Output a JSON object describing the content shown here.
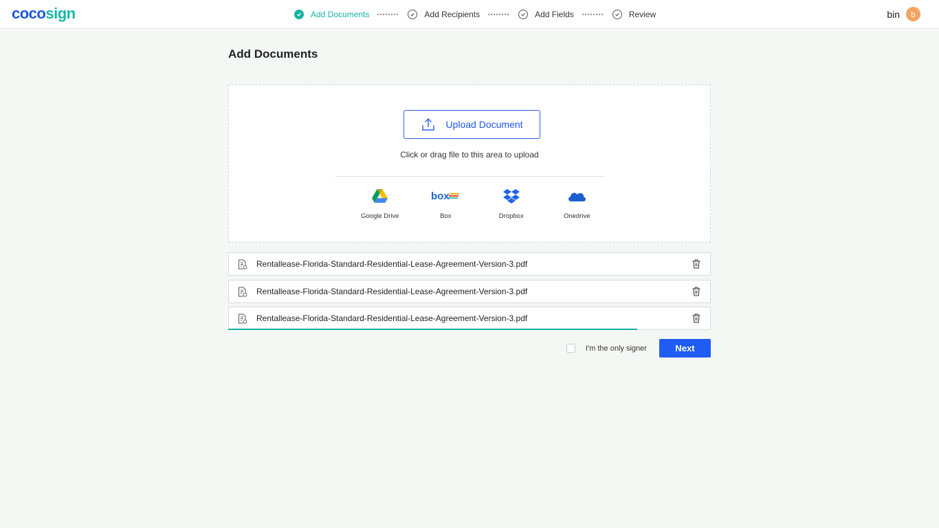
{
  "app": {
    "logo_part1": "coco",
    "logo_part2": "sign"
  },
  "steps": [
    {
      "label": "Add Documents",
      "active": true
    },
    {
      "label": "Add Recipients",
      "active": false
    },
    {
      "label": "Add Fields",
      "active": false
    },
    {
      "label": "Review",
      "active": false
    }
  ],
  "user": {
    "name": "bin",
    "initial": "b",
    "avatar_color": "#f4a261"
  },
  "page": {
    "title": "Add Documents"
  },
  "upload": {
    "button_label": "Upload Document",
    "hint": "Click or drag file to this area to upload",
    "providers": [
      {
        "label": "Google Drive",
        "icon": "google-drive-icon"
      },
      {
        "label": "Box",
        "icon": "box-icon"
      },
      {
        "label": "Dropbox",
        "icon": "dropbox-icon"
      },
      {
        "label": "Onedrive",
        "icon": "onedrive-icon"
      }
    ]
  },
  "files": [
    {
      "name": "Rentallease-Florida-Standard-Residential-Lease-Agreement-Version-3.pdf",
      "upload_progress": 1.0
    },
    {
      "name": "Rentallease-Florida-Standard-Residential-Lease-Agreement-Version-3.pdf",
      "upload_progress": 1.0
    },
    {
      "name": "Rentallease-Florida-Standard-Residential-Lease-Agreement-Version-3.pdf",
      "upload_progress": 0.85
    }
  ],
  "footer": {
    "only_signer_label": "I'm the only signer",
    "only_signer_checked": false,
    "next_label": "Next"
  },
  "colors": {
    "accent": "#16b3a3",
    "primary": "#1f5cf4",
    "background": "#f4f8f5"
  }
}
